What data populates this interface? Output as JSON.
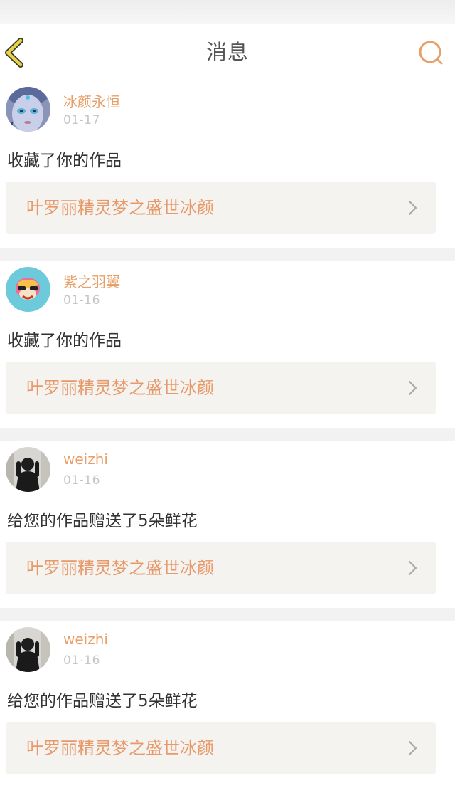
{
  "header": {
    "title": "消息",
    "back_icon": "chevron-left-icon",
    "search_icon": "search-icon",
    "accent_color": "#e8a06a",
    "back_icon_color": "#e8d44a"
  },
  "messages": [
    {
      "username": "冰颜永恒",
      "date": "01-17",
      "action": "收藏了你的作品",
      "work_title": "叶罗丽精灵梦之盛世冰颜",
      "avatar": "ice-princess-avatar"
    },
    {
      "username": "紫之羽翼",
      "date": "01-16",
      "action": "收藏了你的作品",
      "work_title": "叶罗丽精灵梦之盛世冰颜",
      "avatar": "monkey-avatar"
    },
    {
      "username": "weizhi",
      "date": "01-16",
      "action": "给您的作品赠送了5朵鲜花",
      "work_title": "叶罗丽精灵梦之盛世冰颜",
      "avatar": "person-photo-avatar"
    },
    {
      "username": "weizhi",
      "date": "01-16",
      "action": "给您的作品赠送了5朵鲜花",
      "work_title": "叶罗丽精灵梦之盛世冰颜",
      "avatar": "person-photo-avatar"
    }
  ]
}
